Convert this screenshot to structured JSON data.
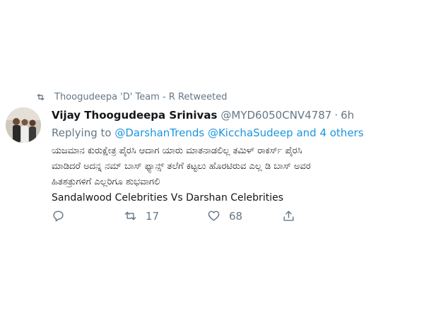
{
  "retweet_banner": {
    "text": "Thoogudeepa 'D' Team - R Retweeted",
    "icon": "retweet-icon"
  },
  "tweet": {
    "display_name": "Vijay Thoogudeepa Srinivas",
    "handle": "@MYD6050CNV4787",
    "separator": "·",
    "time": "6h",
    "reply_prefix": "Replying to",
    "reply_mentions": [
      "@DarshanTrends",
      "@KicchaSudeep"
    ],
    "reply_others": "and 4 others",
    "body_lines": [
      "ಯಜಮಾನ ಕುರುಕ್ಷೇತ್ರ ಪೈರಸಿ ಆದಾಗ ಯಾರು ಮಾತನಾಡಲಿಲ್ಲ ತಮಿಳ್ ರಾಕರ್ಸ್ ಪೈರಸಿ",
      "ಮಾಡಿದರೆ ಅದನ್ನ ನಮ್ ಬಾಸ್ ಫ್ಯಾನ್ಸ್ ತಲೆಗೆ ಕಟ್ಟಲು ಹೊರಟಿರುವ ಎಲ್ಲ ಡಿ ಬಾಸ್ ಅವರ",
      "ಹಿತಶತ್ರುಗಳಿಗೆ ಎಲ್ಲರಿಗೂ ಶುಭವಾಗಲಿ"
    ],
    "body_last_line": "Sandalwood Celebrities Vs Darshan Celebrities"
  },
  "actions": {
    "reply_icon": "reply-icon",
    "retweet_icon": "retweet-icon",
    "retweet_count": "17",
    "like_icon": "heart-icon",
    "like_count": "68",
    "share_icon": "share-icon"
  },
  "colors": {
    "text": "#14171a",
    "muted": "#657786",
    "link": "#1b95e0"
  }
}
